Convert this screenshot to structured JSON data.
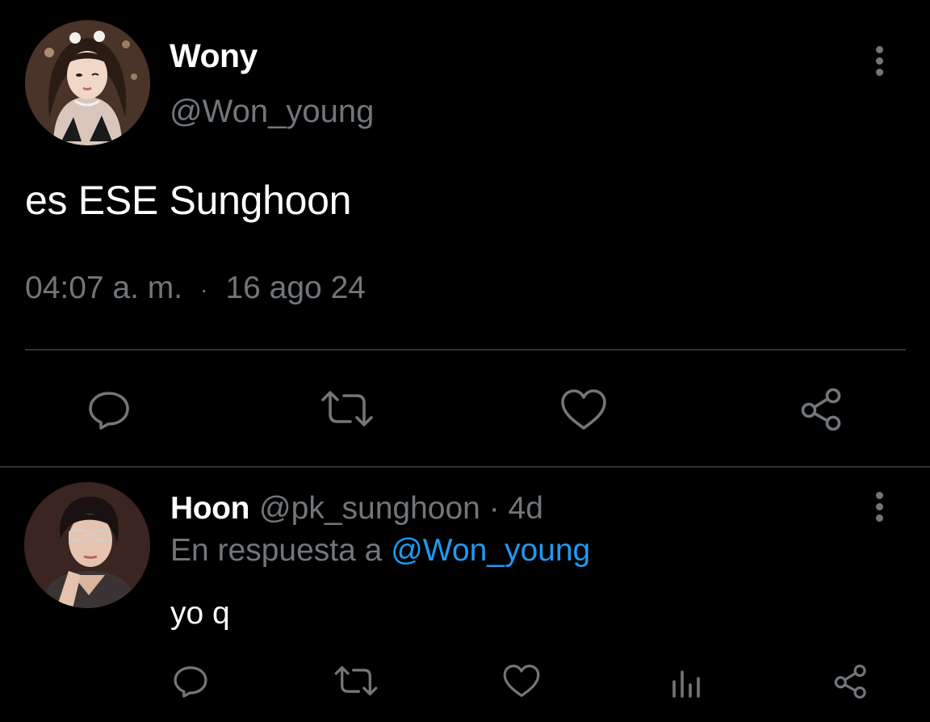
{
  "main_tweet": {
    "author_name": "Wony",
    "author_handle": "@Won_young",
    "text": "es ESE Sunghoon",
    "time": "04:07 a. m.",
    "separator": "·",
    "date": "16 ago 24",
    "actions": [
      "reply-icon",
      "retweet-icon",
      "like-icon",
      "share-icon"
    ]
  },
  "reply": {
    "author_name": "Hoon",
    "author_handle": "@pk_sunghoon",
    "separator": "·",
    "age": "4d",
    "replying_to_prefix": "En respuesta a",
    "replying_to_handle": "@Won_young",
    "text": "yo q",
    "actions": [
      "reply-icon",
      "retweet-icon",
      "like-icon",
      "analytics-icon",
      "share-icon"
    ]
  },
  "colors": {
    "background": "#000000",
    "text_primary": "#ffffff",
    "text_secondary": "#71767b",
    "link": "#1d9bf0",
    "divider": "#2f3336"
  }
}
